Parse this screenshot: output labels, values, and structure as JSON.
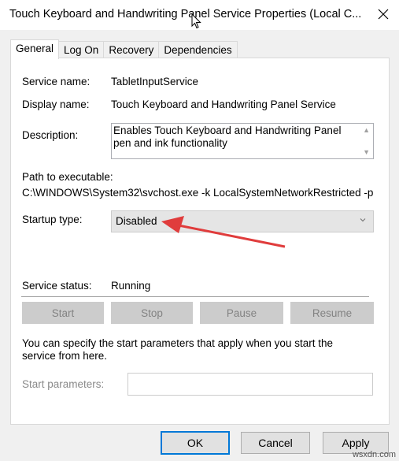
{
  "window": {
    "title": "Touch Keyboard and Handwriting Panel Service Properties (Local C..."
  },
  "tabs": [
    {
      "label": "General"
    },
    {
      "label": "Log On"
    },
    {
      "label": "Recovery"
    },
    {
      "label": "Dependencies"
    }
  ],
  "general": {
    "service_name_label": "Service name:",
    "service_name_value": "TabletInputService",
    "display_name_label": "Display name:",
    "display_name_value": "Touch Keyboard and Handwriting Panel Service",
    "description_label": "Description:",
    "description_value": "Enables Touch Keyboard and Handwriting Panel pen and ink functionality",
    "path_label": "Path to executable:",
    "path_value": "C:\\WINDOWS\\System32\\svchost.exe -k LocalSystemNetworkRestricted -p",
    "startup_type_label": "Startup type:",
    "startup_type_value": "Disabled",
    "service_status_label": "Service status:",
    "service_status_value": "Running",
    "buttons": {
      "start": "Start",
      "stop": "Stop",
      "pause": "Pause",
      "resume": "Resume"
    },
    "start_params_help": "You can specify the start parameters that apply when you start the service from here.",
    "start_params_label": "Start parameters:",
    "start_params_value": ""
  },
  "footer": {
    "ok": "OK",
    "cancel": "Cancel",
    "apply": "Apply"
  },
  "watermark": "wsxdn.com",
  "colors": {
    "annotation_arrow": "#e03c3c",
    "focus_border": "#0078d7"
  }
}
